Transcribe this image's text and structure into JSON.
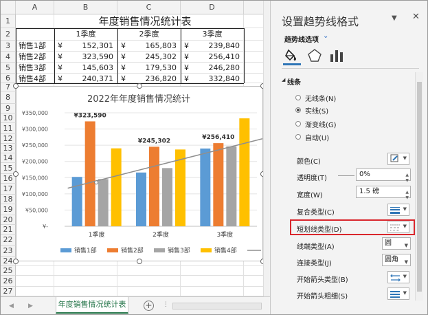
{
  "columns": [
    "A",
    "B",
    "C",
    "D"
  ],
  "rows": [
    "1",
    "2",
    "3",
    "4",
    "5",
    "6",
    "7",
    "8",
    "9",
    "10",
    "11",
    "12",
    "13",
    "14",
    "15",
    "16",
    "17",
    "18",
    "19",
    "20",
    "21",
    "22",
    "23",
    "24",
    "25",
    "26",
    "27"
  ],
  "table": {
    "title": "年度销售情况统计表",
    "headers": [
      "1季度",
      "2季度",
      "3季度"
    ],
    "currency": "¥",
    "data": [
      {
        "name": "销售1部",
        "values": [
          "152,301",
          "165,803",
          "239,840"
        ]
      },
      {
        "name": "销售2部",
        "values": [
          "323,590",
          "245,302",
          "256,410"
        ]
      },
      {
        "name": "销售3部",
        "values": [
          "145,603",
          "179,530",
          "246,280"
        ]
      },
      {
        "name": "销售4部",
        "values": [
          "240,371",
          "236,820",
          "332,840"
        ]
      }
    ]
  },
  "chart_data": {
    "type": "bar",
    "title": "2022年年度销售情况统计",
    "categories": [
      "1季度",
      "2季度",
      "3季度"
    ],
    "series": [
      {
        "name": "销售1部",
        "color": "#5b9bd5",
        "values": [
          152301,
          165803,
          239840
        ]
      },
      {
        "name": "销售2部",
        "color": "#ed7d31",
        "values": [
          323590,
          245302,
          256410
        ]
      },
      {
        "name": "销售3部",
        "color": "#a5a5a5",
        "values": [
          145603,
          179530,
          246280
        ]
      },
      {
        "name": "销售4部",
        "color": "#ffc000",
        "values": [
          240371,
          236820,
          332840
        ]
      }
    ],
    "y_ticks": [
      "¥350,000",
      "¥300,000",
      "¥250,000",
      "¥200,000",
      "¥150,000",
      "¥100,000",
      "¥50,000",
      "¥-"
    ],
    "ylim": [
      0,
      350000
    ],
    "data_labels": [
      {
        "series": 1,
        "category": 0,
        "text": "¥323,590"
      },
      {
        "series": 1,
        "category": 1,
        "text": "¥245,302"
      },
      {
        "series": 1,
        "category": 2,
        "text": "¥256,410"
      }
    ],
    "trendline": {
      "series": 2,
      "type": "linear",
      "color": "#8f8f8f"
    },
    "legend_position": "bottom",
    "grid": true
  },
  "sheet_tab": "年度销售情况统计表",
  "add_sheet_label": "+",
  "pane": {
    "title": "设置趋势线格式",
    "subtitle": "趋势线选项",
    "section": "线条",
    "options": [
      "无线条(N)",
      "实线(S)",
      "渐变线(G)",
      "自动(U)"
    ],
    "selected_option": 1,
    "props": {
      "color": "颜色(C)",
      "transparency": "透明度(T)",
      "transparency_value": "0%",
      "width": "宽度(W)",
      "width_value": "1.5 磅",
      "compound": "复合类型(C)",
      "dash": "短划线类型(D)",
      "cap": "线端类型(A)",
      "cap_value": "圆",
      "join": "连接类型(J)",
      "join_value": "圆角",
      "arrow_begin_type": "开始箭头类型(B)",
      "arrow_begin_size": "开始箭头粗细(S)"
    },
    "accent": "#2e75b6",
    "highlight_color": "#d9262c"
  }
}
